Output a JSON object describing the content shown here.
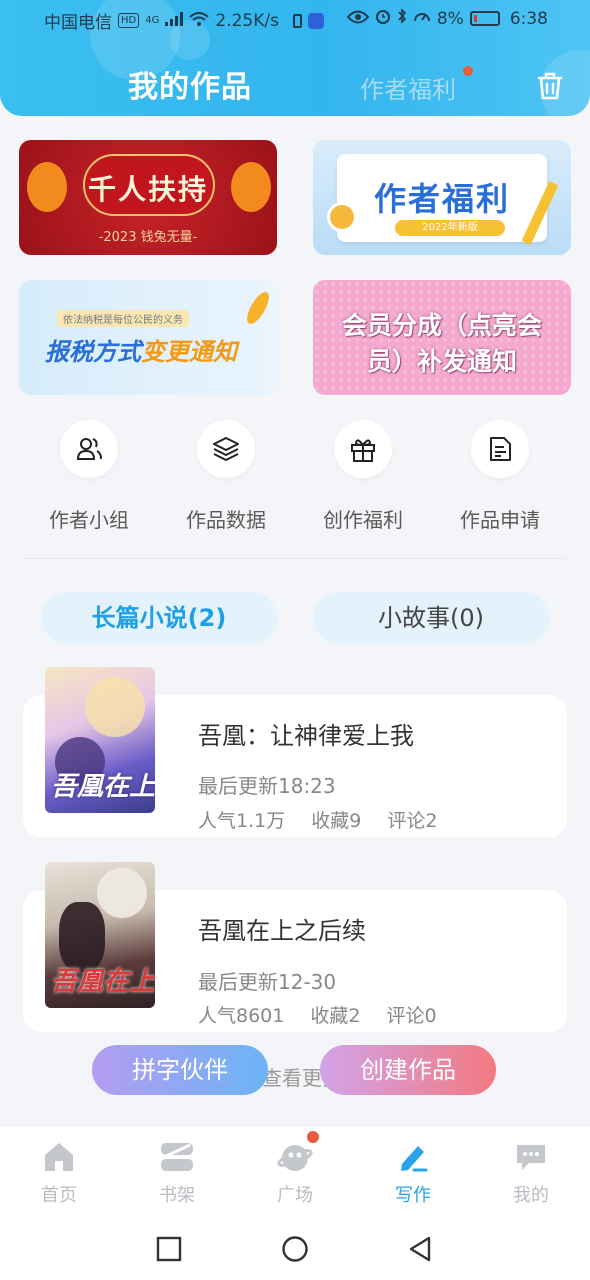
{
  "status_bar": {
    "carrier": "中国电信",
    "hd": "HD",
    "network": "4G",
    "speed": "2.25K/s",
    "battery": "8%",
    "time": "6:38"
  },
  "header": {
    "title": "我的作品",
    "tab_welfare": "作者福利"
  },
  "banners": [
    {
      "title": "千人扶持",
      "subtitle": "-2023 钱兔无量-"
    },
    {
      "title": "作者福利",
      "tag": "2022年新版"
    },
    {
      "note": "依法纳税是每位公民的义务",
      "title_a": "报税方式",
      "title_b": "变更通知"
    },
    {
      "line1": "会员分成（点亮会",
      "line2": "员）补发通知"
    }
  ],
  "quick_actions": [
    {
      "label": "作者小组",
      "icon": "people-icon"
    },
    {
      "label": "作品数据",
      "icon": "layers-icon"
    },
    {
      "label": "创作福利",
      "icon": "gift-icon"
    },
    {
      "label": "作品申请",
      "icon": "document-icon"
    }
  ],
  "categories": [
    {
      "label": "长篇小说(2)",
      "active": true
    },
    {
      "label": "小故事(0)",
      "active": false
    }
  ],
  "works": [
    {
      "cover_text": "吾凰在上",
      "title": "吾凰：让神律爱上我",
      "updated": "最后更新18:23",
      "popularity": "人气1.1万",
      "favorites": "收藏9",
      "comments": "评论2"
    },
    {
      "cover_text": "吾凰在上",
      "title": "吾凰在上之后续",
      "updated": "最后更新12-30",
      "popularity": "人气8601",
      "favorites": "收藏2",
      "comments": "评论0"
    }
  ],
  "more_text": "查看更多数据",
  "fab": {
    "left": "拼字伙伴",
    "right": "创建作品"
  },
  "bottom_nav": [
    {
      "label": "首页",
      "icon": "home-icon"
    },
    {
      "label": "书架",
      "icon": "bookshelf-icon"
    },
    {
      "label": "广场",
      "icon": "planet-icon"
    },
    {
      "label": "写作",
      "icon": "pen-icon",
      "active": true
    },
    {
      "label": "我的",
      "icon": "chat-bubble-icon"
    }
  ],
  "colors": {
    "accent": "#2aa3e8",
    "header_bg": "#33b5ee",
    "badge": "#ea5a3c",
    "fab_right": "#f27a80"
  }
}
